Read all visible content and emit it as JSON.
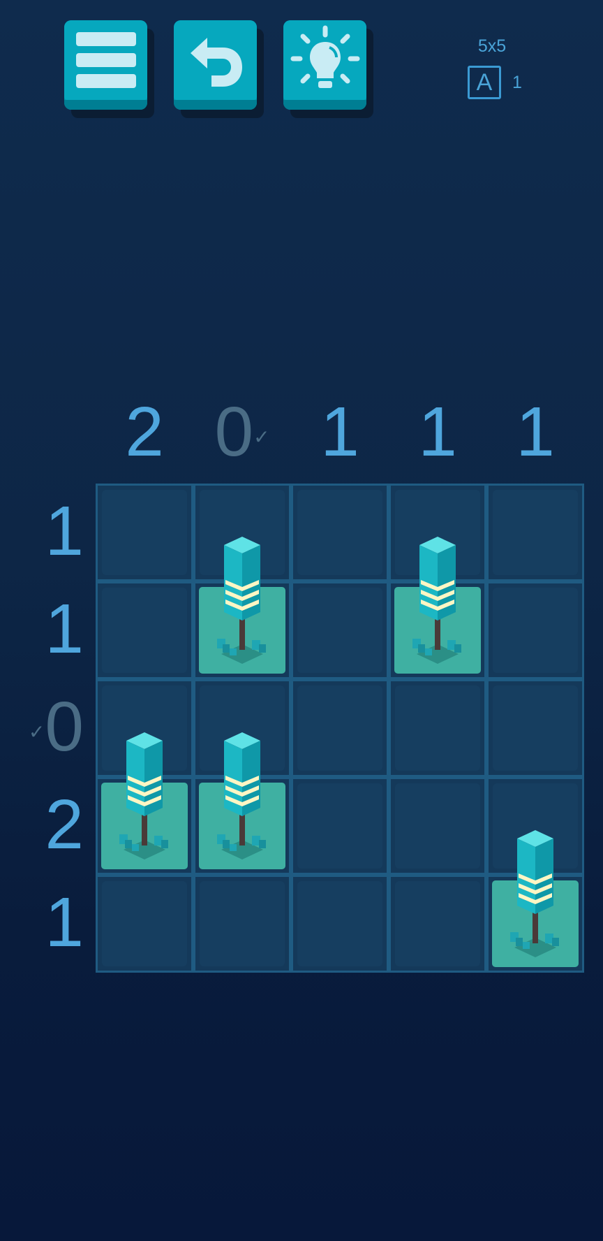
{
  "toolbar": {
    "menu_icon": "hamburger-menu-icon",
    "undo_icon": "undo-arrow-icon",
    "hint_icon": "lightbulb-hint-icon"
  },
  "level": {
    "size": "5x5",
    "badge_letter": "A",
    "badge_count": "1"
  },
  "colors": {
    "accent": "#06a8be",
    "clue": "#4fa6dd",
    "clue_done": "#4a6c85",
    "lamp_tile": "#3fb0a2",
    "background": "#0d2646"
  },
  "puzzle": {
    "columns": [
      "2",
      "0",
      "1",
      "1",
      "1"
    ],
    "columns_done": [
      false,
      true,
      false,
      false,
      false
    ],
    "rows": [
      "1",
      "1",
      "0",
      "2",
      "1"
    ],
    "rows_done": [
      false,
      false,
      true,
      false,
      false
    ],
    "lamps": [
      {
        "row": 2,
        "col": 2
      },
      {
        "row": 2,
        "col": 4
      },
      {
        "row": 4,
        "col": 1
      },
      {
        "row": 4,
        "col": 2
      },
      {
        "row": 5,
        "col": 5
      }
    ]
  }
}
